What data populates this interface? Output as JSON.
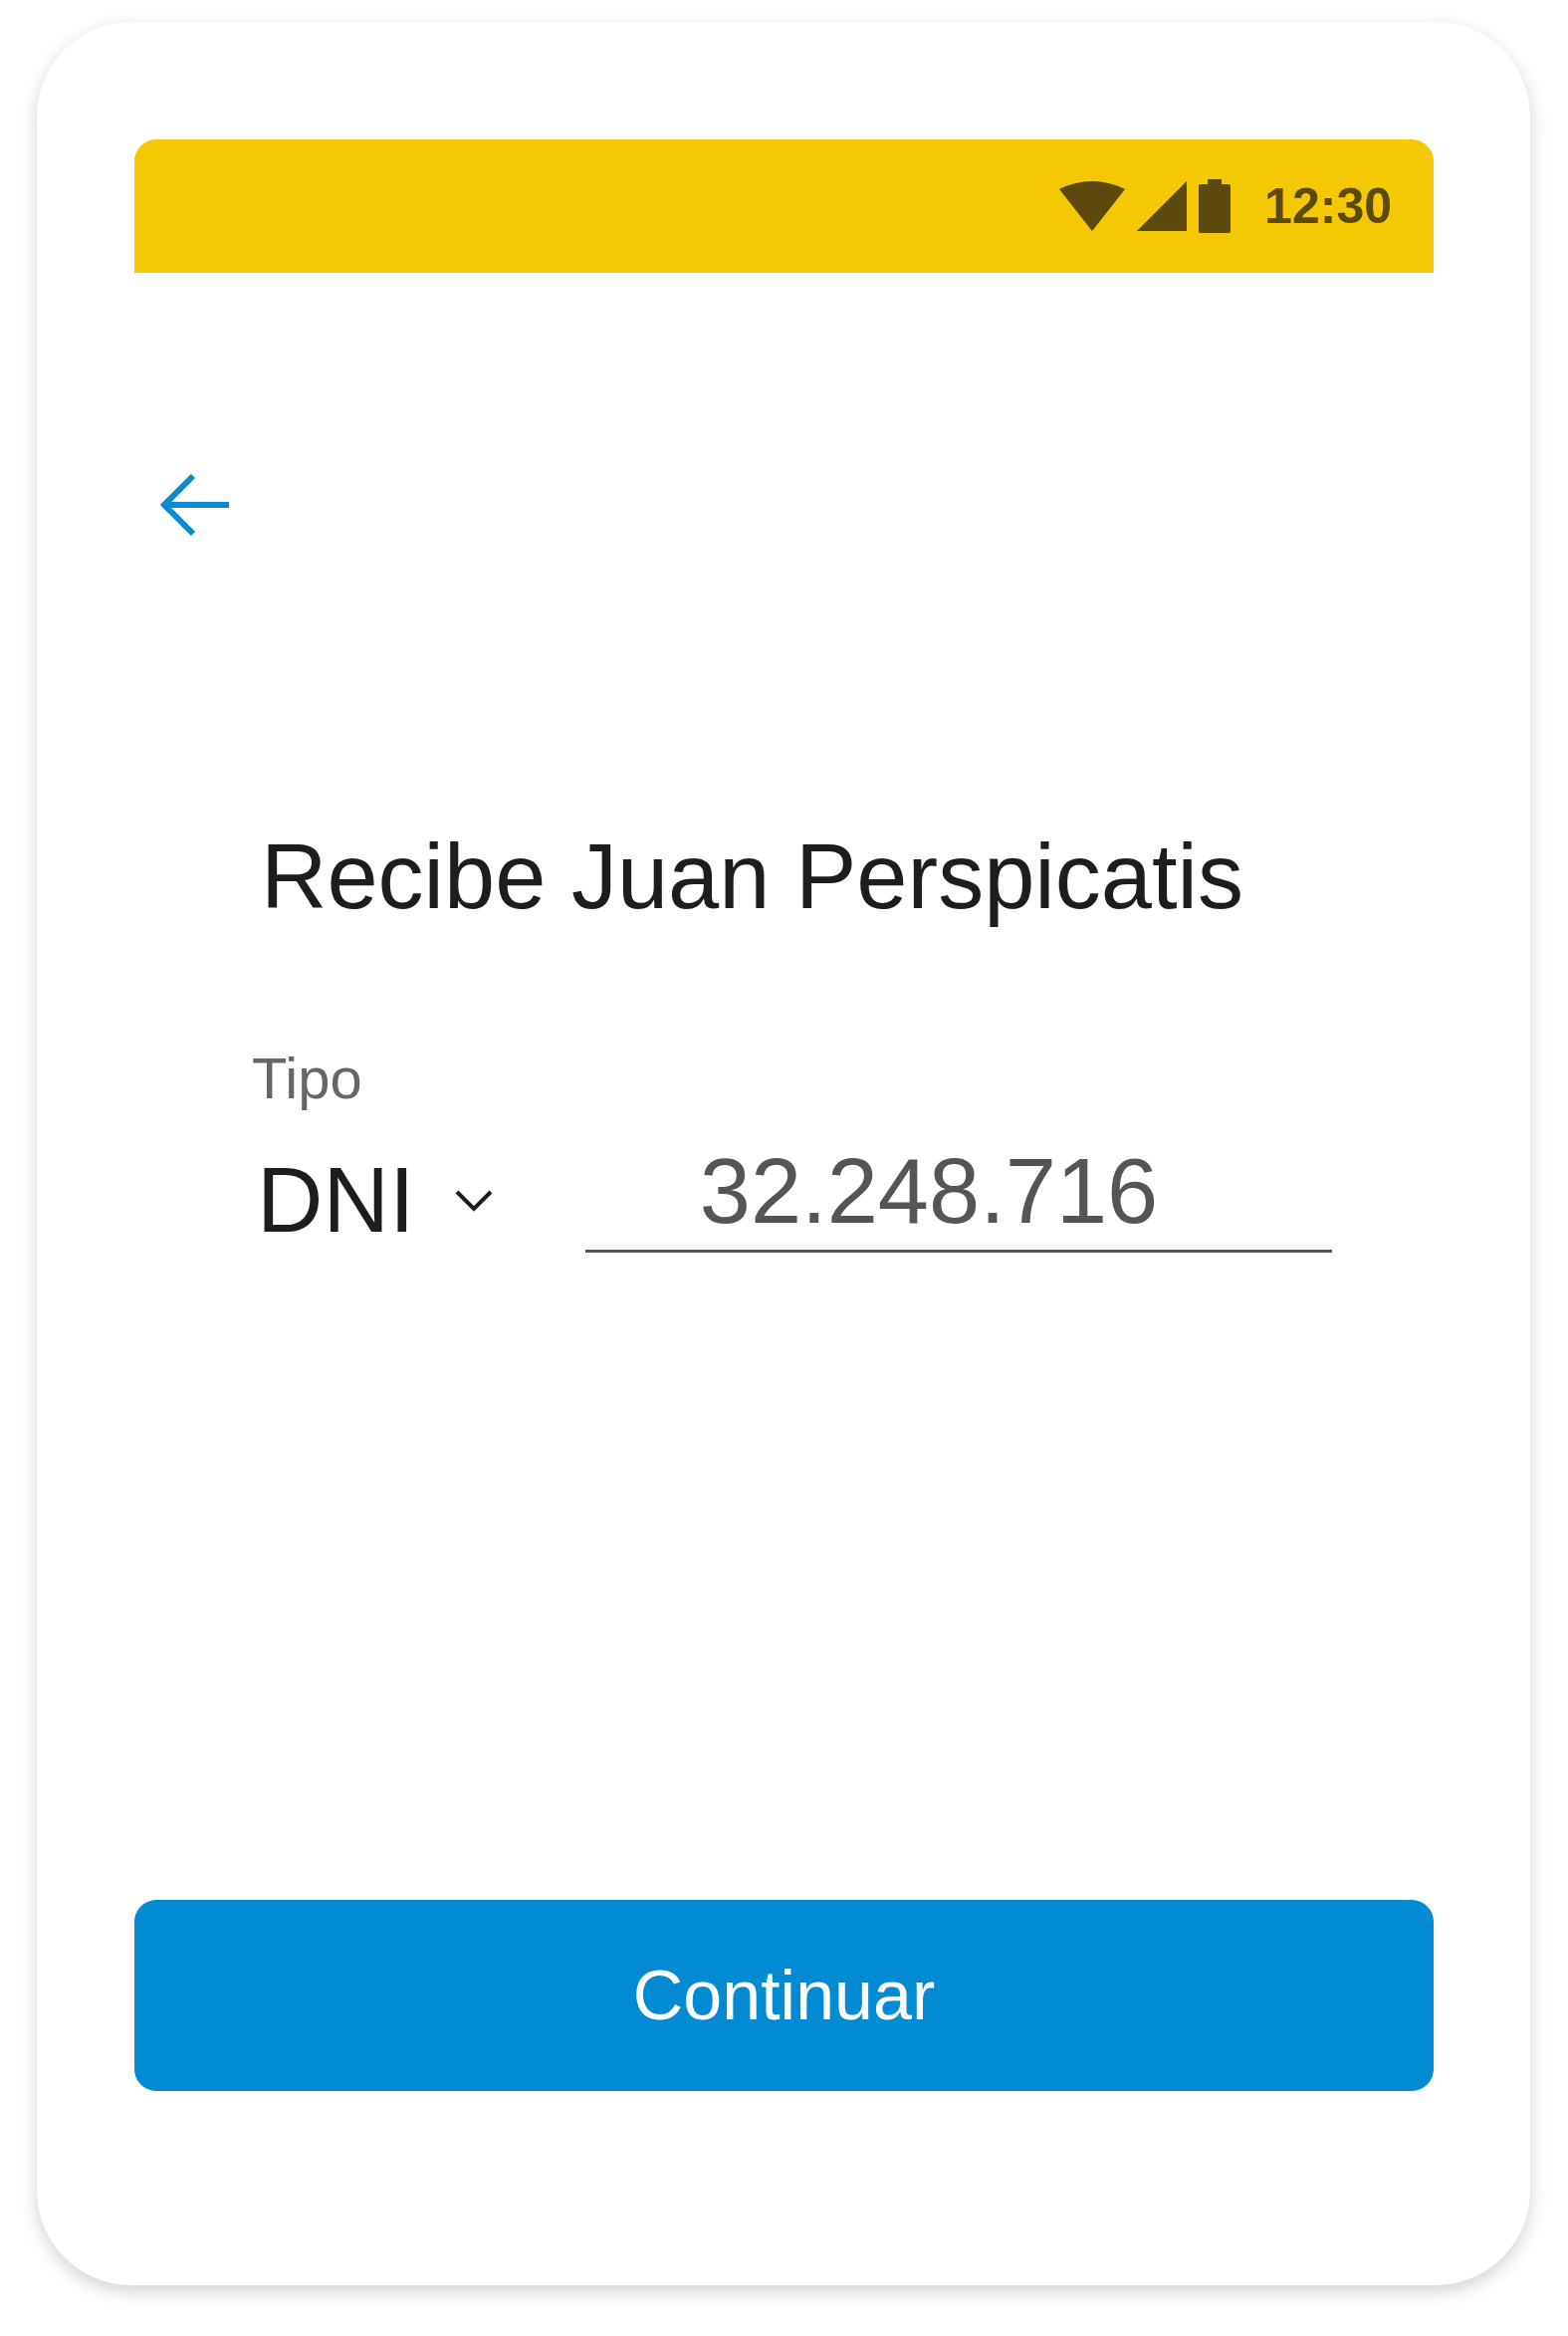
{
  "status_bar": {
    "time": "12:30"
  },
  "title": "Recibe Juan Perspicatis",
  "document": {
    "label": "Tipo",
    "type": "DNI",
    "number": "32.248.716"
  },
  "button": "Continuar"
}
